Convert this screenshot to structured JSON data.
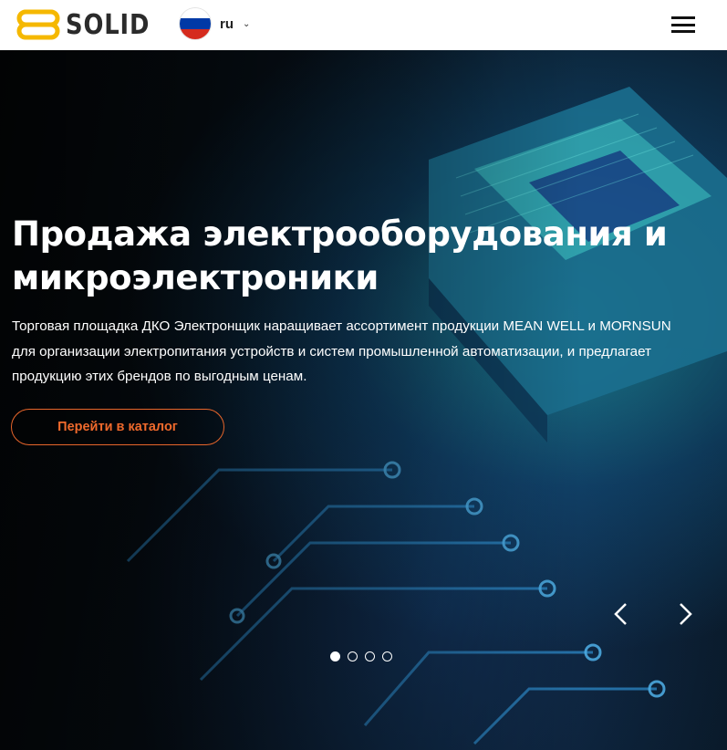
{
  "header": {
    "logo_text": "SOLID",
    "logo_colors": {
      "mark": "#F5B800",
      "text": "#2B2B2B"
    },
    "language": {
      "code": "ru",
      "flag": [
        "#FFFFFF",
        "#0039A6",
        "#D52B1E"
      ]
    },
    "menu_icon": "hamburger-menu-icon"
  },
  "hero": {
    "title": "Продажа электрооборудования и микроэлектроники",
    "text": "Торговая площадка ДКО Электронщик наращивает ассортимент продукции MEAN WELL и MORNSUN для организации электропитания устройств и систем промышленной автоматизации, и предлагает продукцию этих брендов по выгодным ценам.",
    "cta_label": "Перейти в каталог",
    "accent_color": "#F06A2C",
    "background_image": "circuit-board-chip",
    "slider": {
      "prev_icon": "chevron-left-icon",
      "next_icon": "chevron-right-icon",
      "slides": 4,
      "active_slide": 1
    }
  }
}
